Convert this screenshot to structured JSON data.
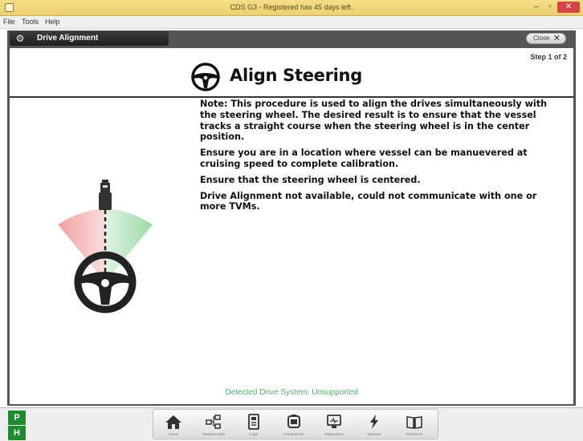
{
  "window": {
    "title": "CDS G3 - Registered has 45 days left.",
    "buttons": {
      "minimize": "–",
      "maximize": "▫",
      "close": "✕"
    }
  },
  "menu": [
    "File",
    "Tools",
    "Help"
  ],
  "panel": {
    "title": "Drive Alignment",
    "close_label": "Close",
    "close_glyph": "✕"
  },
  "step_label": "Step 1 of 2",
  "page_title": "Align Steering",
  "notes": [
    "Note: This procedure is used to align the drives simultaneously with the steering wheel.  The desired result is to ensure that the vessel tracks a straight course when the steering wheel is in the center position.",
    "Ensure you are in a location where vessel can be manuevered at cruising speed to complete calibration.",
    "Ensure that the steering wheel is centered.",
    "Drive Alignment not available, could not communicate with one or more TVMs."
  ],
  "detected_text": "Detected Drive System: Unsupported",
  "side_badges": {
    "p": "P",
    "h": "H"
  },
  "nav": [
    {
      "label": "Home",
      "icon": "home-icon"
    },
    {
      "label": "Modules Data",
      "icon": "modules-icon"
    },
    {
      "label": "Logs",
      "icon": "logs-icon"
    },
    {
      "label": "Components",
      "icon": "components-icon"
    },
    {
      "label": "Diagnostics",
      "icon": "diagnostics-icon"
    },
    {
      "label": "Services",
      "icon": "lightning-icon"
    },
    {
      "label": "Reference",
      "icon": "book-icon"
    }
  ],
  "colors": {
    "titlebar": "#ecd071",
    "frame": "#555555",
    "badge_green": "#1f8a2e",
    "detected_text": "#5aa86e",
    "wedge_red": "#f2a0a0",
    "wedge_green": "#9ed9a8"
  }
}
